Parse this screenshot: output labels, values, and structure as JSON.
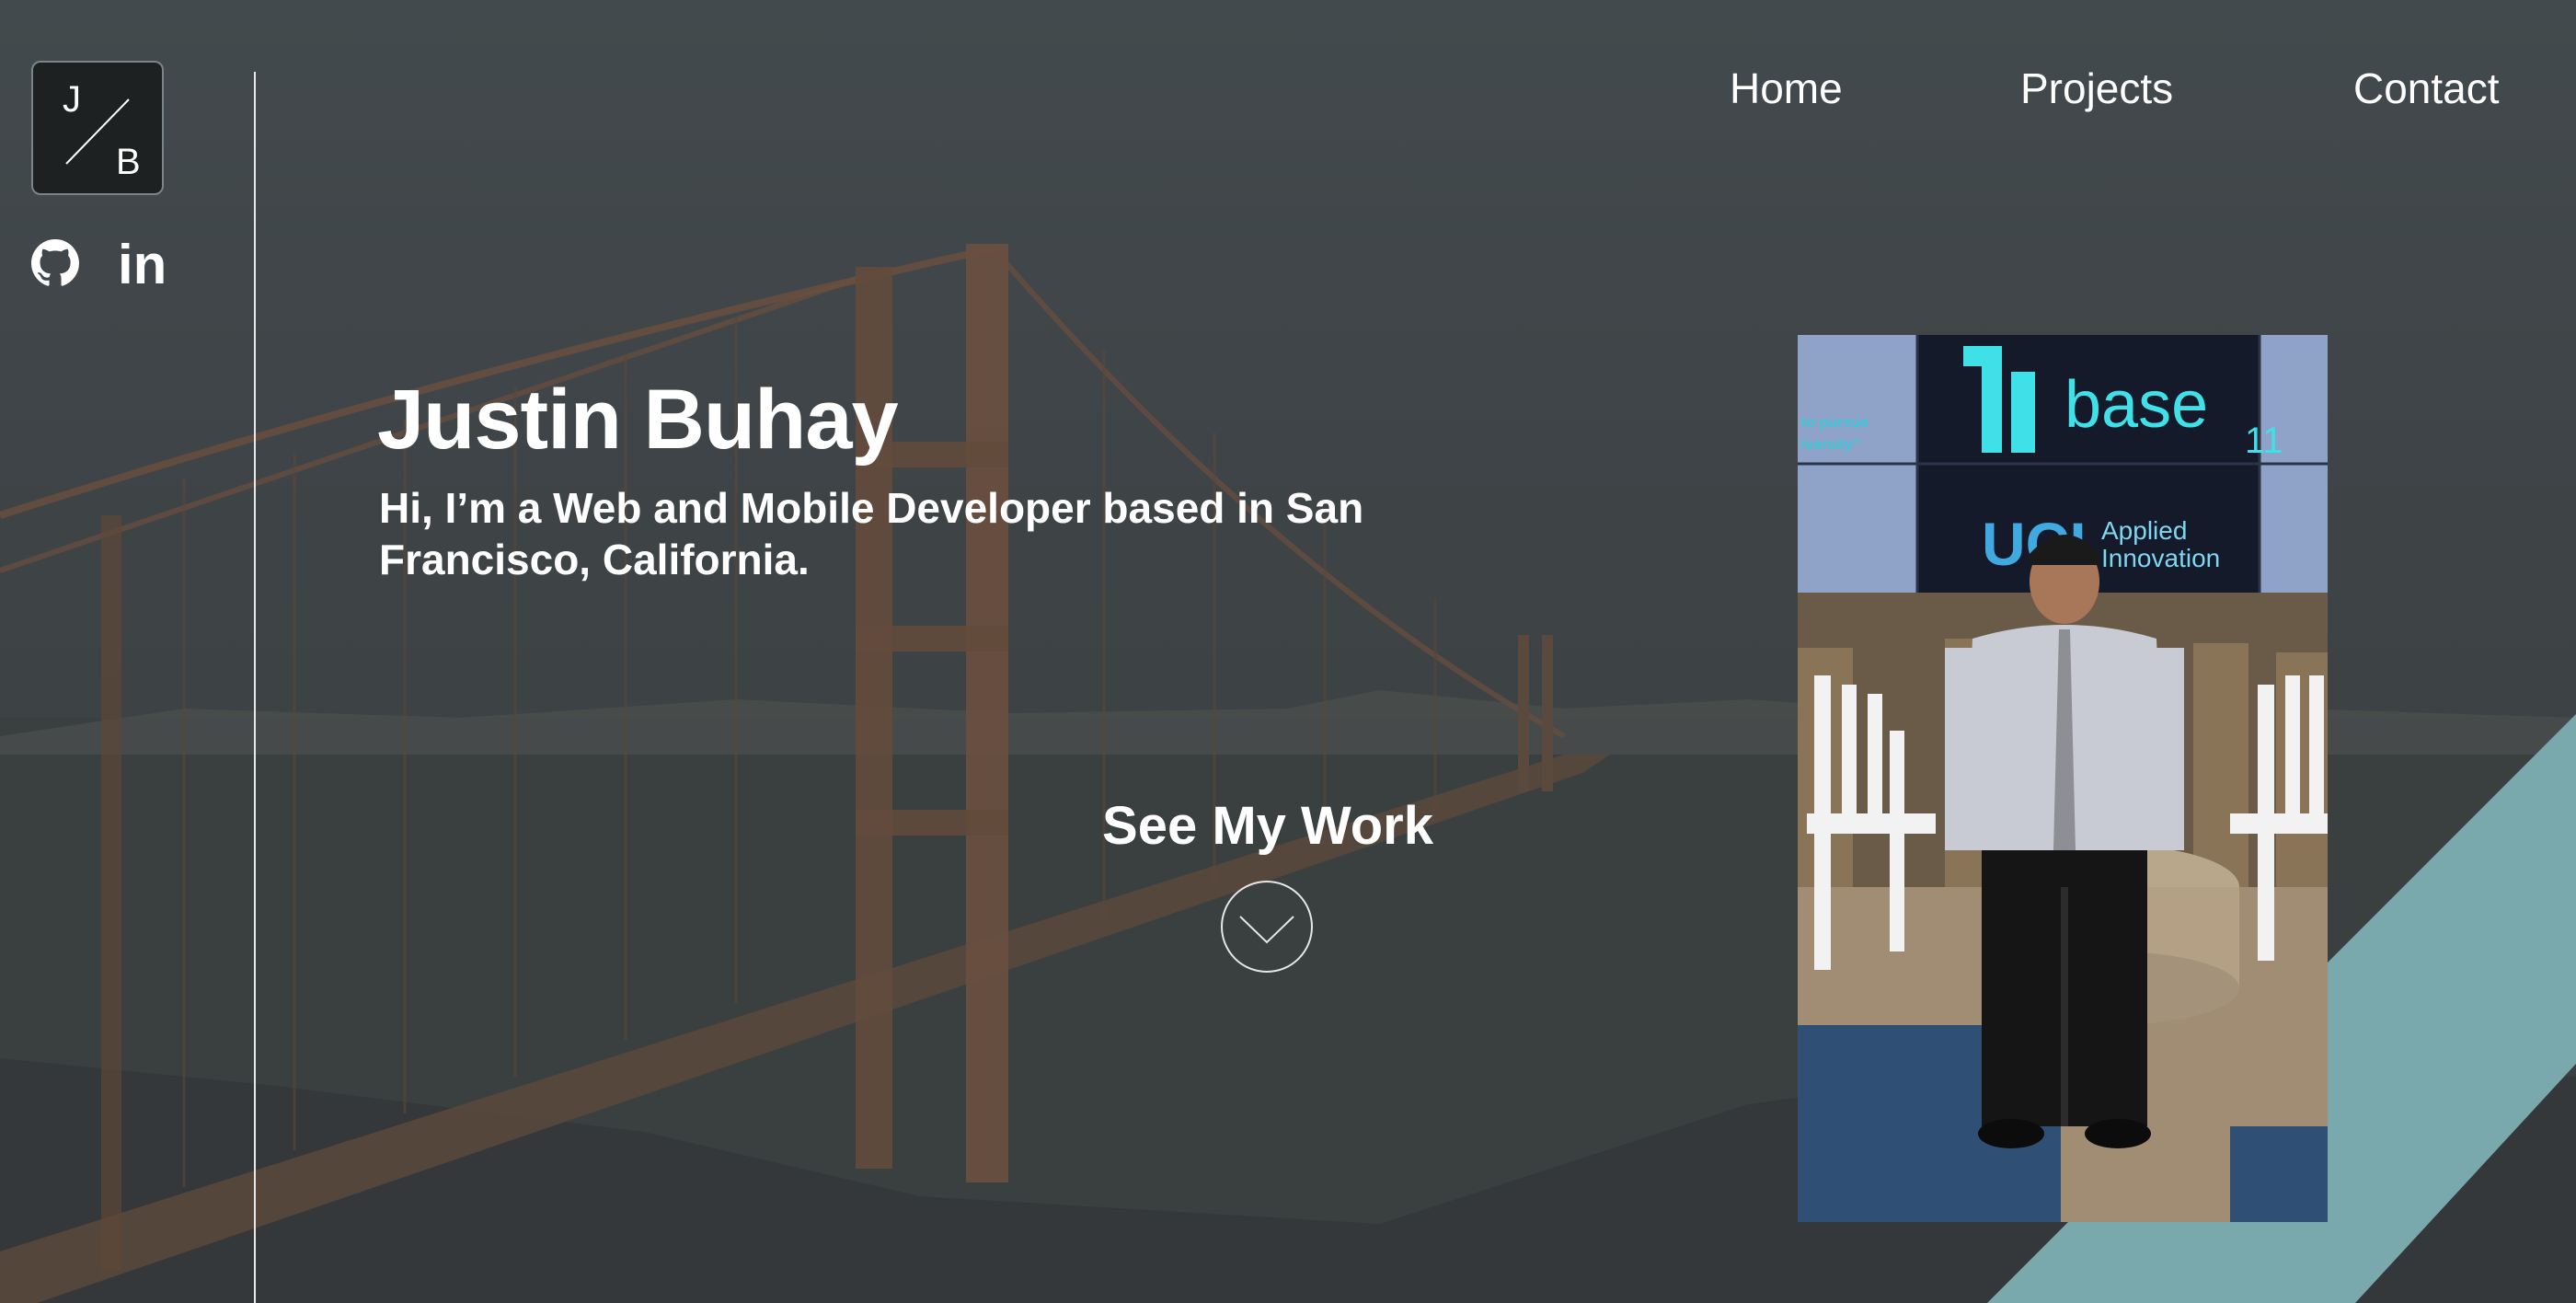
{
  "logo": {
    "letter_top": "J",
    "letter_bottom": "B"
  },
  "social": {
    "linkedin_label": "in"
  },
  "nav": {
    "items": [
      {
        "label": "Home"
      },
      {
        "label": "Projects"
      },
      {
        "label": "Contact"
      }
    ]
  },
  "hero": {
    "name": "Justin Buhay",
    "tagline": "Hi, I’m a Web and Mobile Developer based in San Francisco, California.",
    "cta_label": "See My Work"
  },
  "photo": {
    "screen_brand": "base",
    "screen_brand_sub": "11",
    "screen_org": "UCI",
    "screen_org_line1": "Applied",
    "screen_org_line2": "Innovation",
    "screen_side_left_1": "to pursue",
    "screen_side_left_2": "iversity\""
  },
  "colors": {
    "accent_teal": "#7aa9ad",
    "background": "#3e4446",
    "text": "#ffffff"
  },
  "icons": {
    "github": "github-icon",
    "linkedin": "linkedin-icon",
    "cta": "chevron-down-icon"
  }
}
